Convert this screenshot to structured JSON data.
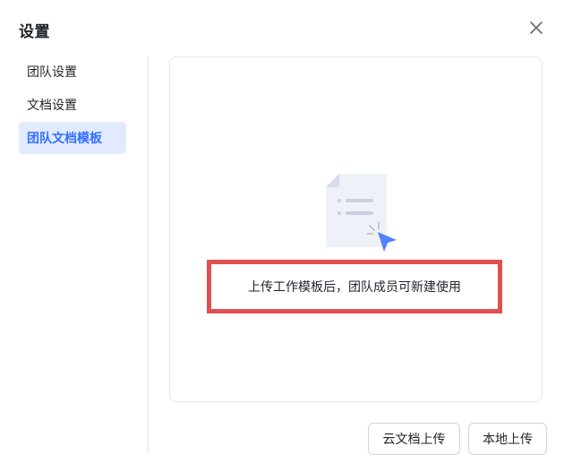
{
  "dialog": {
    "title": "设置"
  },
  "sidebar": {
    "items": [
      {
        "label": "团队设置",
        "active": false
      },
      {
        "label": "文档设置",
        "active": false
      },
      {
        "label": "团队文档模板",
        "active": true
      }
    ]
  },
  "main": {
    "empty_hint": "上传工作模板后，团队成员可新建使用"
  },
  "footer": {
    "cloud_upload_label": "云文档上传",
    "local_upload_label": "本地上传"
  },
  "icons": {
    "close": "close-icon",
    "illustration": "document-upload-illustration"
  },
  "colors": {
    "accent": "#3370ff",
    "active_bg": "#e1eaff",
    "highlight_border": "#e05050"
  }
}
